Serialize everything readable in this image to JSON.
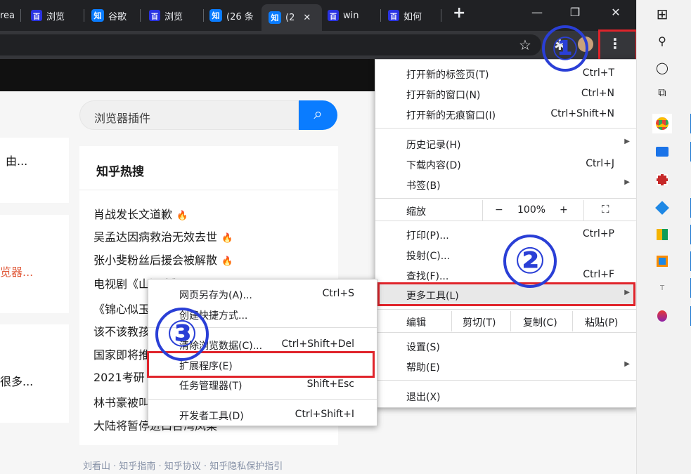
{
  "tabs": [
    {
      "fav": "",
      "title": "rea"
    },
    {
      "fav": "baidu",
      "title": "浏览"
    },
    {
      "fav": "zhihu",
      "title": "谷歌"
    },
    {
      "fav": "baidu",
      "title": "浏览"
    },
    {
      "fav": "zhihu",
      "title": "(26 条"
    },
    {
      "fav": "zhihu",
      "title": "(2",
      "close": "✕"
    },
    {
      "fav": "baidu",
      "title": "win"
    },
    {
      "fav": "baidu",
      "title": "如何"
    }
  ],
  "fav_labels": {
    "baidu": "百",
    "zhihu": "知"
  },
  "new_tab": "+",
  "window_controls": {
    "minimize": "—",
    "restore": "❐",
    "close": "✕"
  },
  "toolbar": {
    "star": "☆",
    "extensions": "✱",
    "menu": "⋮"
  },
  "search": {
    "value": "浏览器插件",
    "button_icon": "⌕"
  },
  "left_snippets": [
    "由...",
    "览器...",
    "很多..."
  ],
  "hot": {
    "title": "知乎热搜",
    "items": [
      "肖战发长文道歉",
      "吴孟达因病救治无效去世",
      "张小斐粉丝后援会被解散",
      "电视剧《山河令》",
      "《锦心似玉》",
      "该不该教孩子",
      "国家即将推出",
      "2021考研",
      "林书豪被叫",
      "大陆将暂停进口台湾凤梨"
    ],
    "flame": "🔥"
  },
  "footer_links": "刘看山 · 知乎指南 · 知乎协议 · 知乎隐私保护指引",
  "main_menu": {
    "new_tab": {
      "label": "打开新的标签页(T)",
      "shortcut": "Ctrl+T"
    },
    "new_window": {
      "label": "打开新的窗口(N)",
      "shortcut": "Ctrl+N"
    },
    "incognito": {
      "label": "打开新的无痕窗口(I)",
      "shortcut": "Ctrl+Shift+N"
    },
    "history": {
      "label": "历史记录(H)",
      "arrow": "▶"
    },
    "downloads": {
      "label": "下载内容(D)",
      "shortcut": "Ctrl+J"
    },
    "bookmarks": {
      "label": "书签(B)",
      "arrow": "▶"
    },
    "zoom": {
      "label": "缩放",
      "minus": "−",
      "value": "100%",
      "plus": "+",
      "fullscreen": "⛶"
    },
    "print": {
      "label": "打印(P)...",
      "shortcut": "Ctrl+P"
    },
    "cast": {
      "label": "投射(C)..."
    },
    "find": {
      "label": "查找(F)...",
      "shortcut": "Ctrl+F"
    },
    "more_tools": {
      "label": "更多工具(L)",
      "arrow": "▶"
    },
    "edit": {
      "label": "编辑",
      "cut": "剪切(T)",
      "copy": "复制(C)",
      "paste": "粘贴(P)"
    },
    "settings": {
      "label": "设置(S)"
    },
    "help": {
      "label": "帮助(E)",
      "arrow": "▶"
    },
    "exit": {
      "label": "退出(X)"
    }
  },
  "sub_menu": {
    "save_as": {
      "label": "网页另存为(A)...",
      "shortcut": "Ctrl+S"
    },
    "shortcut": {
      "label": "创建快捷方式..."
    },
    "clear": {
      "label": "清除浏览数据(C)...",
      "shortcut": "Ctrl+Shift+Del"
    },
    "extensions": {
      "label": "扩展程序(E)"
    },
    "task_manager": {
      "label": "任务管理器(T)",
      "shortcut": "Shift+Esc"
    },
    "devtools": {
      "label": "开发者工具(D)",
      "shortcut": "Ctrl+Shift+I"
    }
  },
  "annotations": {
    "one": "①",
    "two": "②",
    "three": "③"
  },
  "taskbar": {
    "windows": "⊞",
    "search": "⚲",
    "cortana": "◯",
    "taskview": "⧉"
  },
  "colors": {
    "annotation_red": "#e0242b",
    "annotation_blue": "#2a3fd6",
    "zhihu_blue": "#0a7cff"
  }
}
